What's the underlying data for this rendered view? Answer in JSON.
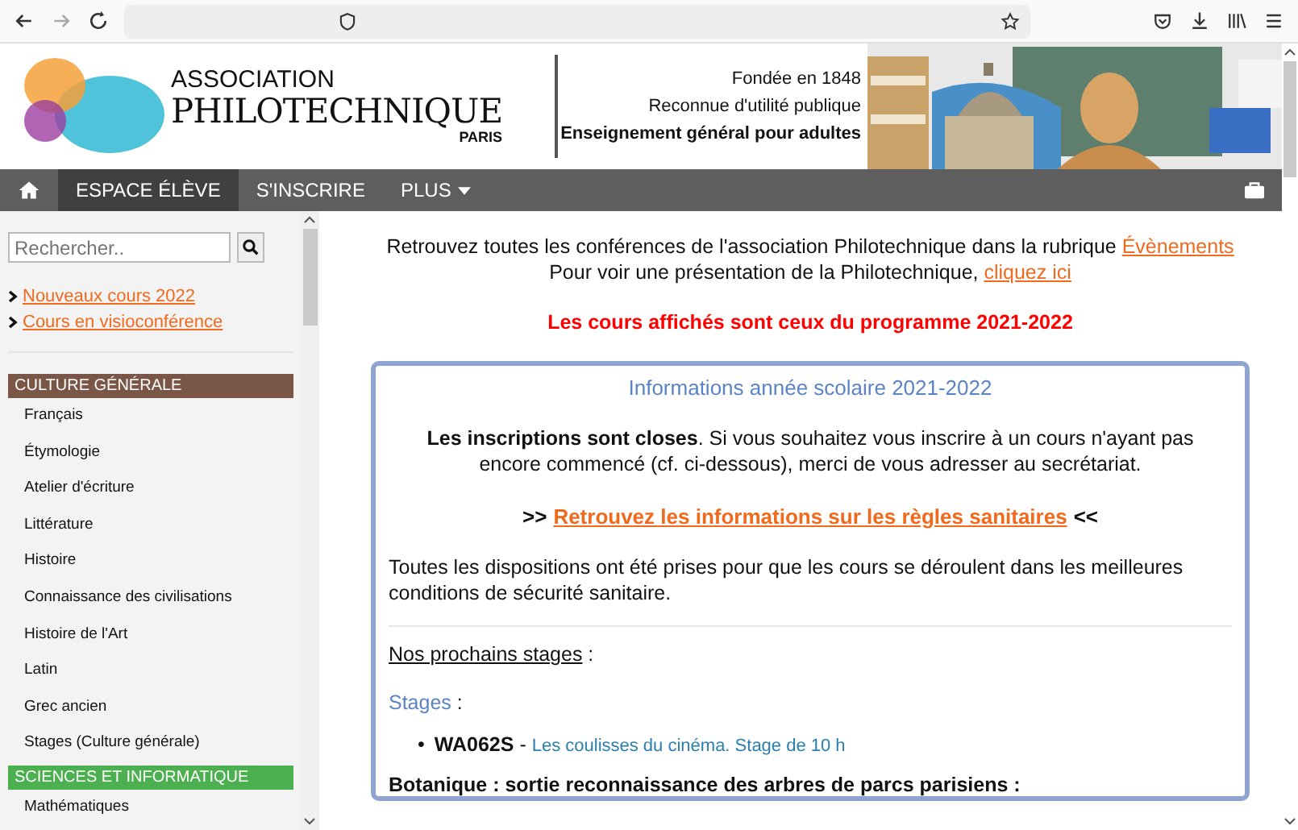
{
  "header": {
    "logo": {
      "line1": "ASSOCIATION",
      "line2": "PHILOTECHNIQUE",
      "line3": "PARIS"
    },
    "taglines": [
      {
        "text": "Fondée en 1848",
        "bold": false
      },
      {
        "text": "Reconnue d'utilité publique",
        "bold": false
      },
      {
        "text": "Enseignement général pour adultes",
        "bold": true
      }
    ]
  },
  "nav": {
    "items": [
      {
        "kind": "home",
        "selected": false
      },
      {
        "kind": "text",
        "label": "ESPACE ÉLÈVE",
        "selected": true
      },
      {
        "kind": "text",
        "label": "S'INSCRIRE",
        "selected": false
      },
      {
        "kind": "dropdown",
        "label": "PLUS",
        "selected": false
      }
    ]
  },
  "sidebar": {
    "search": {
      "placeholder": "Rechercher.."
    },
    "links": [
      "Nouveaux cours 2022",
      "Cours en visioconférence"
    ],
    "sections": [
      {
        "title": "CULTURE GÉNÉRALE",
        "color": "#7a5646",
        "items": [
          "Français",
          "Étymologie",
          "Atelier d'écriture",
          "Littérature",
          "Histoire",
          "Connaissance des civilisations",
          "Histoire de l'Art",
          "Latin",
          "Grec ancien",
          "Stages (Culture générale)"
        ]
      },
      {
        "title": "SCIENCES ET INFORMATIQUE",
        "color": "#4caf50",
        "items": [
          "Mathématiques"
        ]
      }
    ]
  },
  "main": {
    "intro": [
      {
        "text": "Retrouvez toutes les conférences de l'association Philotechnique dans la rubrique ",
        "link": "Évènements"
      },
      {
        "text": "Pour voir une présentation de la Philotechnique, ",
        "link": "cliquez ici"
      }
    ],
    "notice": "Les cours affichés sont ceux du programme 2021-2022",
    "info": {
      "title": "Informations année scolaire 2021-2022",
      "paragraph": "**Les inscriptions sont closes**. Si vous souhaitez vous inscrire à un cours n'ayant pas encore commencé (cf. ci-dessous), merci de vous adresser au secrétariat.",
      "sanitary": {
        "before": ">>",
        "link": "Retrouvez les informations sur les règles sanitaires",
        "after": "<<"
      },
      "dispositions": "Toutes les dispositions ont été prises pour que les cours se déroulent dans les meilleures conditions de sécurité sanitaire.",
      "upcoming": {
        "label": "Nos prochains stages",
        "suffix": " :"
      },
      "stages": {
        "label": "Stages",
        "suffix": " :",
        "items": [
          {
            "bullet": "•",
            "code": "WA062S",
            "sep": " - ",
            "title": "Les coulisses du cinéma. Stage de 10 h"
          }
        ]
      },
      "botanique": "Botanique : sortie reconnaissance des arbres de parcs parisiens :"
    }
  }
}
